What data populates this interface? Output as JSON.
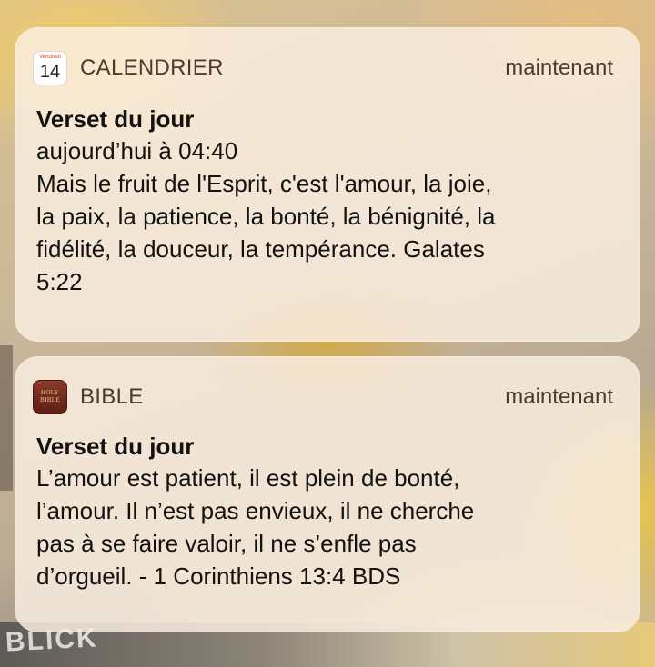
{
  "background": {
    "overlay_text": "BLICK"
  },
  "notifications": [
    {
      "app_name": "CALENDRIER",
      "icon": "calendar-icon",
      "icon_weekday": "Vendredi",
      "icon_day": "14",
      "time": "maintenant",
      "title": "Verset du jour",
      "lines": [
        "aujourd’hui à 04:40",
        "Mais le fruit de l'Esprit, c'est l'amour, la joie,",
        "la paix, la patience, la bonté, la bénignité, la",
        "fidélité, la douceur, la tempérance. Galates",
        "5:22"
      ]
    },
    {
      "app_name": "BIBLE",
      "icon": "bible-icon",
      "icon_text_1": "HOLY",
      "icon_text_2": "BIBLE",
      "time": "maintenant",
      "title": "Verset du jour",
      "lines": [
        "L’amour est patient, il est plein de bonté,",
        "l’amour. Il n’est pas envieux, il ne cherche",
        "pas à se faire valoir, il ne s’enfle pas",
        "d’orgueil. - 1 Corinthiens 13:4 BDS"
      ]
    }
  ]
}
